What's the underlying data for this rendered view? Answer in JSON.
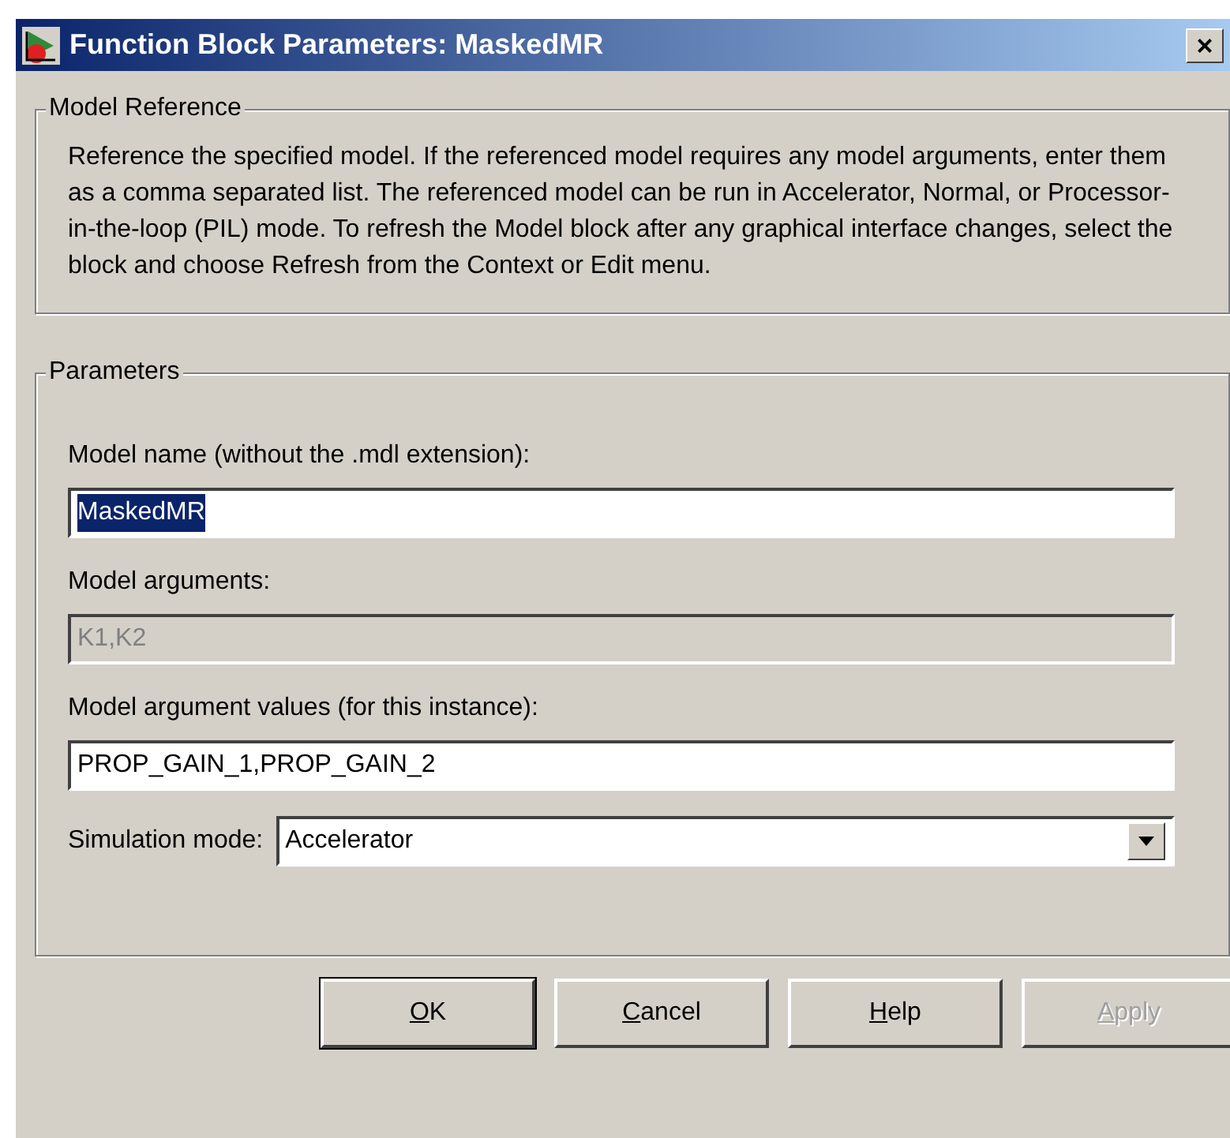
{
  "window": {
    "title": "Function Block Parameters: MaskedMR",
    "close": "×"
  },
  "model_reference": {
    "legend": "Model Reference",
    "description": "Reference the specified model.  If the referenced model requires any model arguments, enter them as a comma separated list.  The referenced model can be run in Accelerator, Normal, or Processor-in-the-loop (PIL) mode.  To refresh the Model block after any graphical interface changes, select the block and choose Refresh from the Context or Edit menu."
  },
  "parameters": {
    "legend": "Parameters",
    "fields": [
      {
        "kind": "text",
        "label": "Model name (without the .mdl extension):",
        "value": "MaskedMR",
        "disabled": false,
        "selected": true
      },
      {
        "kind": "text",
        "label": "Model arguments:",
        "value": "K1,K2",
        "disabled": true,
        "selected": false
      },
      {
        "kind": "text",
        "label": "Model argument values (for this instance):",
        "value": "PROP_GAIN_1,PROP_GAIN_2",
        "disabled": false,
        "selected": false
      },
      {
        "kind": "select",
        "label": "Simulation mode:",
        "value": "Accelerator",
        "disabled": false,
        "selected": false
      }
    ]
  },
  "buttons": [
    {
      "label": "OK",
      "default": true,
      "disabled": false
    },
    {
      "label": "Cancel",
      "default": false,
      "disabled": false
    },
    {
      "label": "Help",
      "default": false,
      "disabled": false
    },
    {
      "label": "Apply",
      "default": false,
      "disabled": true
    }
  ]
}
